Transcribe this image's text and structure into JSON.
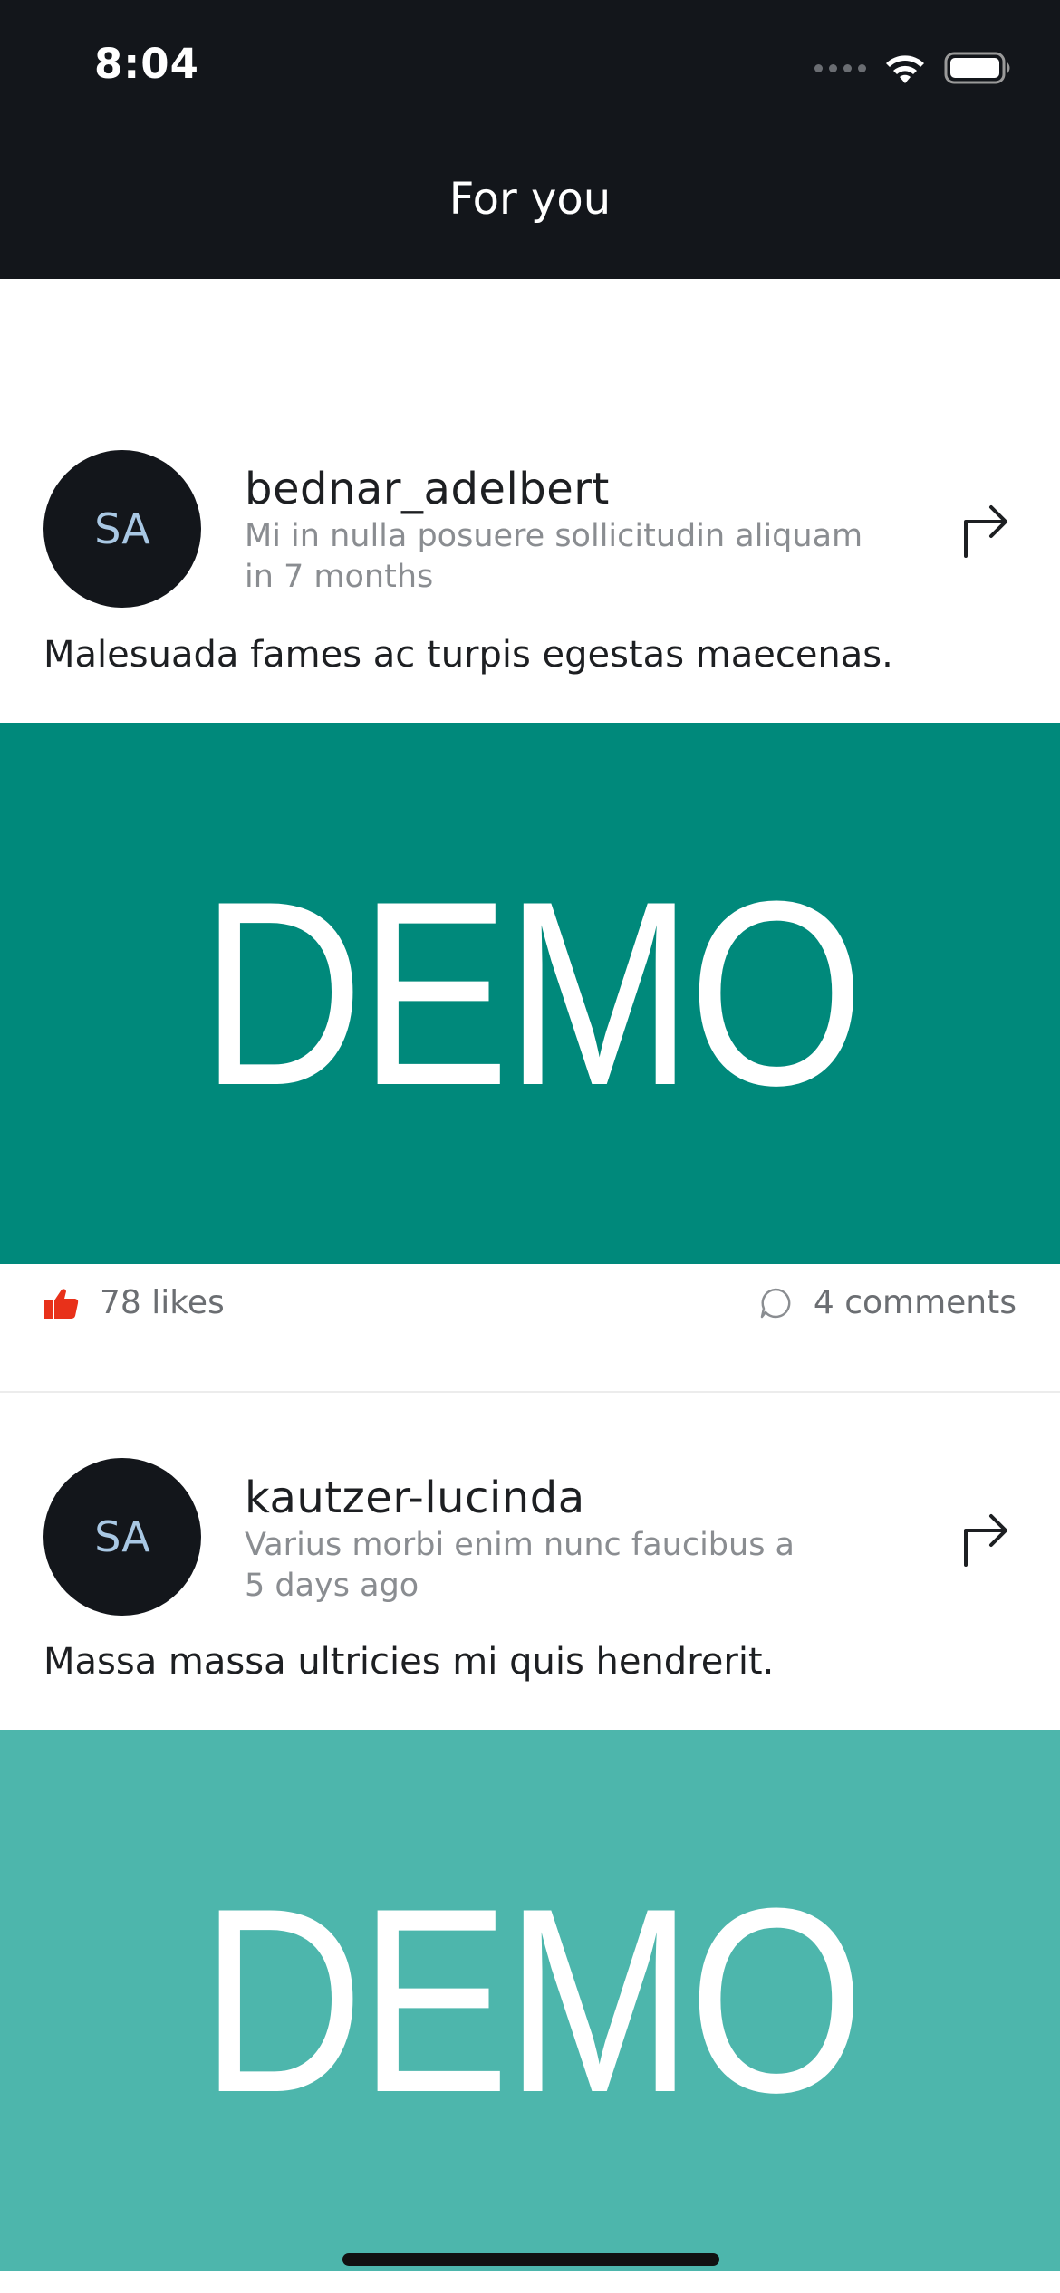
{
  "status_bar": {
    "time": "8:04",
    "icons": [
      "signal-icon",
      "wifi-icon",
      "battery-icon"
    ]
  },
  "nav": {
    "title": "For you"
  },
  "posts": [
    {
      "avatar_initials": "SA",
      "username": "bednar_adelbert",
      "subtitle": "Mi in nulla posuere sollicitudin aliquam",
      "time": "in 7 months",
      "text": "Malesuada fames ac turpis egestas maecenas.",
      "image_text": "DEMO",
      "image_color": "#00897b",
      "likes": "78 likes",
      "comments": "4 comments"
    },
    {
      "avatar_initials": "SA",
      "username": "kautzer-lucinda",
      "subtitle": "Varius morbi enim nunc faucibus a",
      "time": "5 days ago",
      "text": "Massa massa ultricies mi quis hendrerit.",
      "image_text": "DEMO",
      "image_color": "#4db6ac"
    }
  ],
  "colors": {
    "header_bg": "#13161b",
    "like_icon": "#e8311a",
    "avatar_text": "#a9c8e4"
  }
}
